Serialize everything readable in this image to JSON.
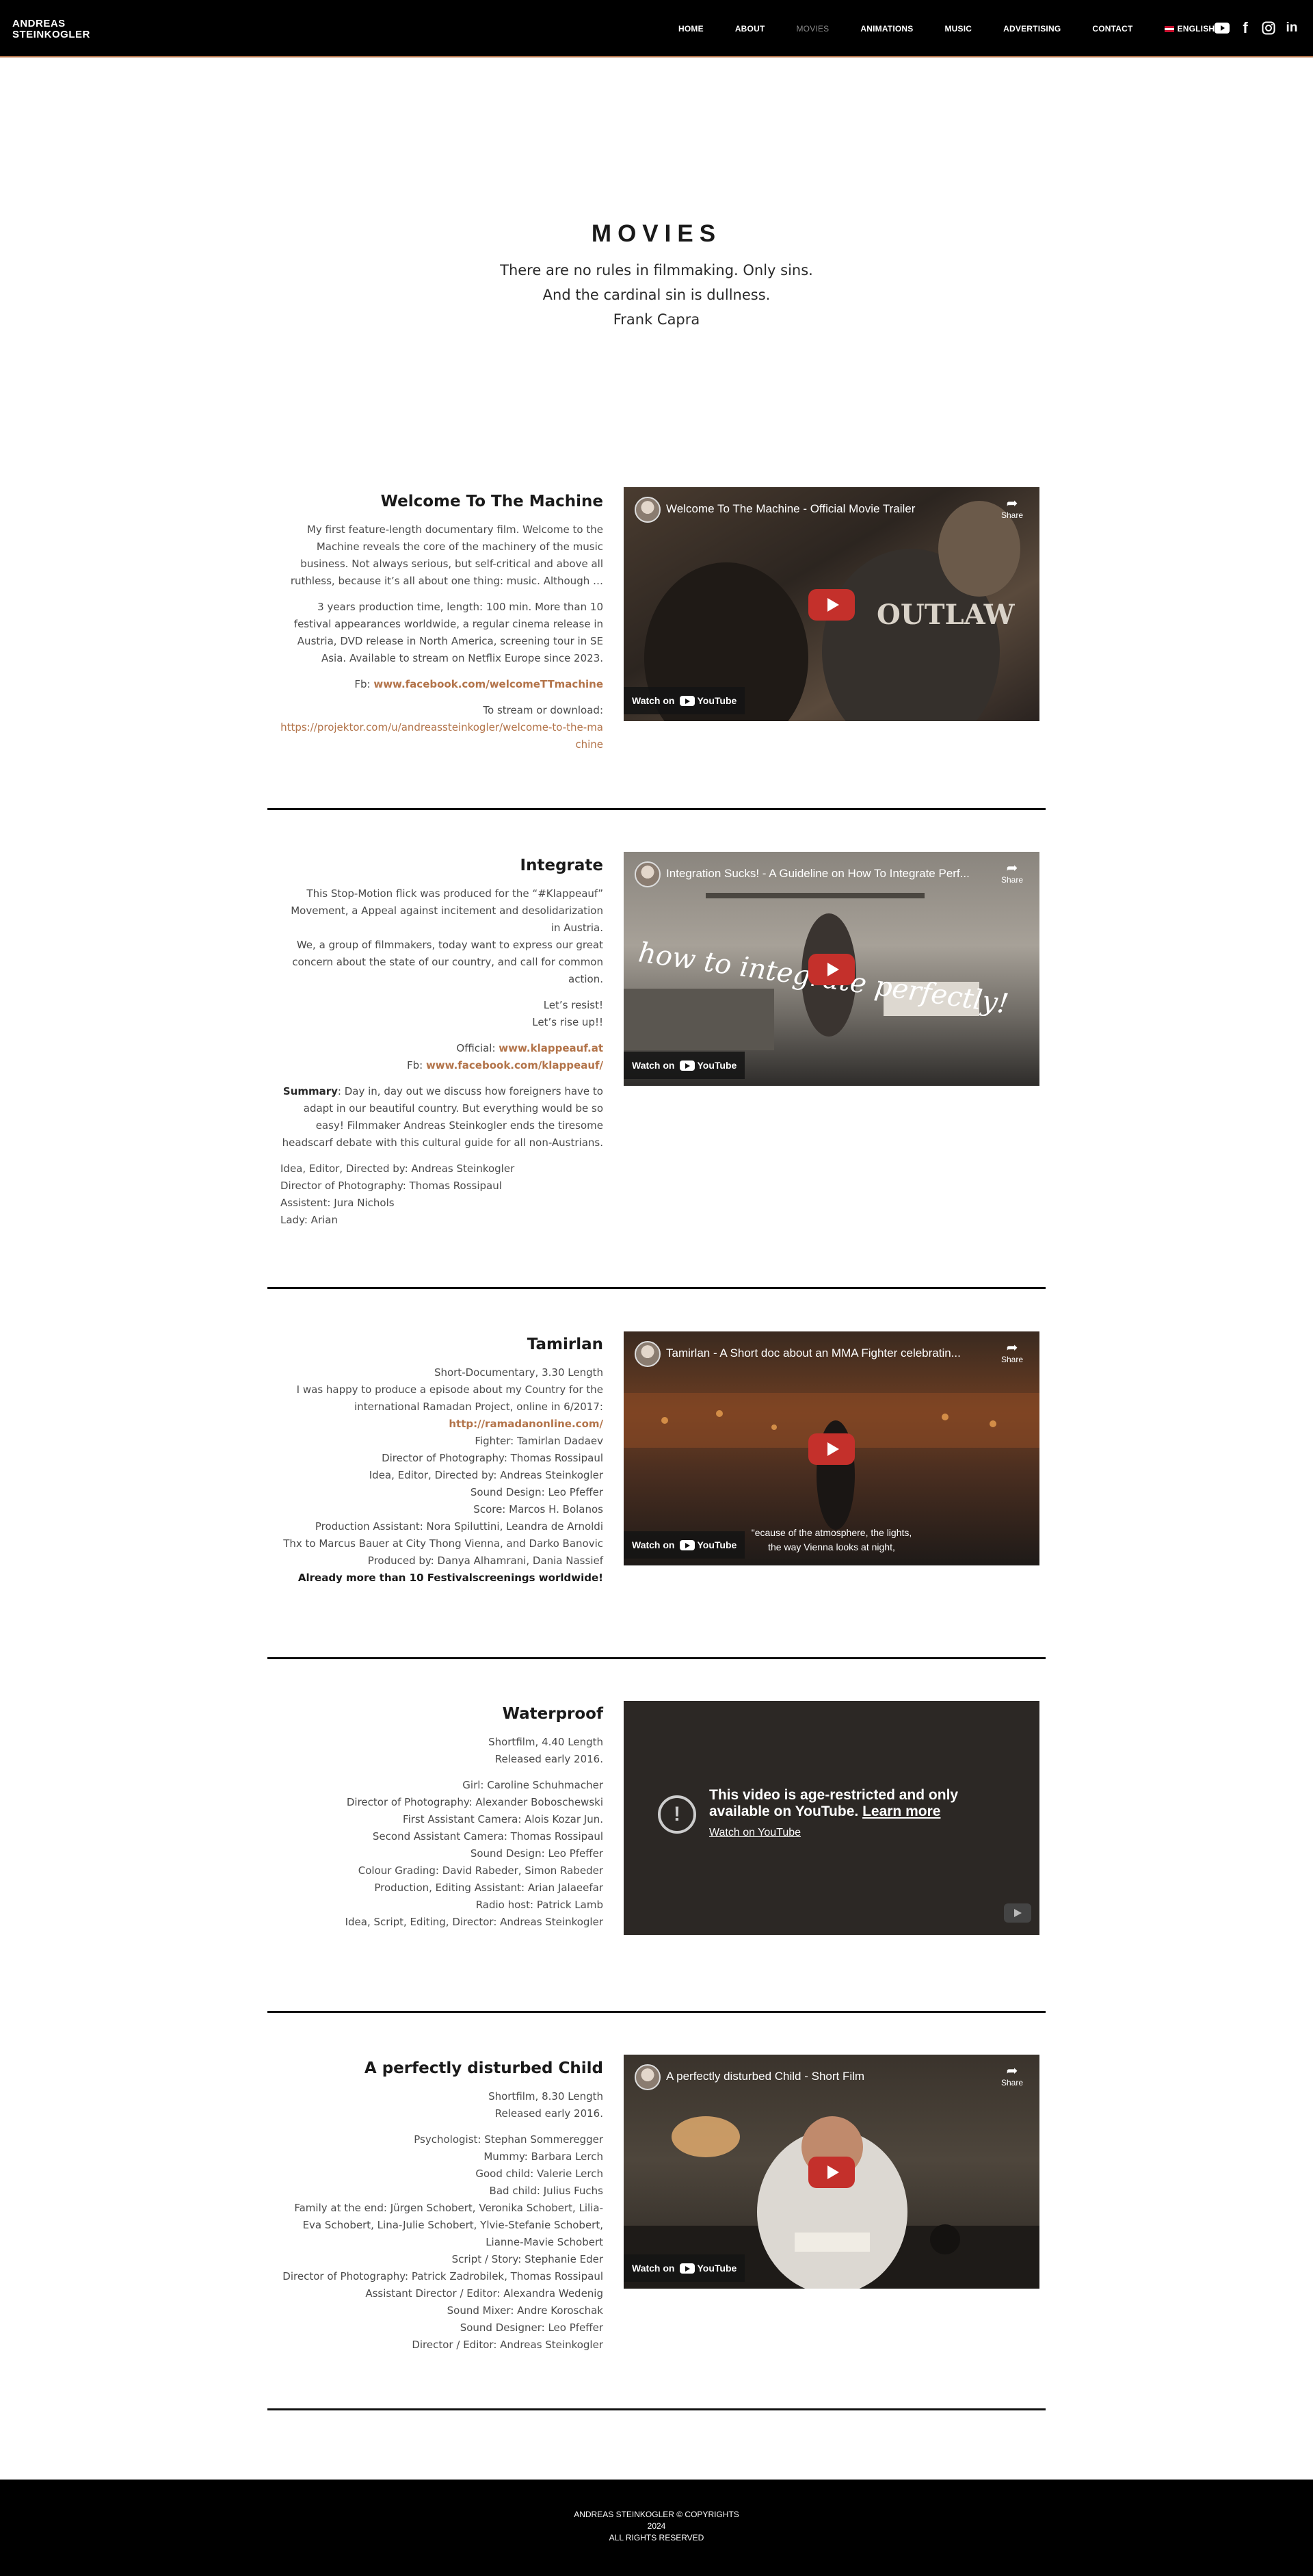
{
  "header": {
    "logo_line1": "ANDREAS",
    "logo_line2": "STEINKOGLER",
    "nav": [
      "HOME",
      "ABOUT",
      "MOVIES",
      "ANIMATIONS",
      "MUSIC",
      "ADVERTISING",
      "CONTACT"
    ],
    "active_nav": "MOVIES",
    "language": "ENGLISH",
    "social": [
      "youtube-icon",
      "facebook-icon",
      "instagram-icon",
      "linkedin-icon"
    ]
  },
  "hero": {
    "title": "MOVIES",
    "quote_line1": "There are no rules in filmmaking. Only sins.",
    "quote_line2": "And the cardinal sin is dullness.",
    "author": "Frank Capra"
  },
  "movies": [
    {
      "title": "Welcome To The Machine",
      "p1": "My first feature-length documentary film.  Welcome to the Machine reveals the core of the machinery of the music business. Not always serious, but self-critical and above all ruthless, because it’s all about one thing: music. Although …",
      "p2": "3 years production time, length: 100 min. More than 10 festival appearances worldwide, a regular cinema release in Austria, DVD release in North America, screening tour in SE Asia. Available to stream on Netflix Europe since 2023.",
      "fb_label": "Fb: ",
      "fb_link": "www.facebook.com/welcomeTTmachine",
      "stream_label": "To stream or download:",
      "stream_link": "https://projektor.com/u/andreassteinkogler/welcome-to-the-machine",
      "video": {
        "title": "Welcome To The Machine - Official Movie Trailer",
        "watch": "Watch on",
        "yt": "YouTube",
        "share": "Share"
      }
    },
    {
      "title": "Integrate",
      "p1": "This Stop-Motion flick was produced for the “#Klappeauf” Movement, a Appeal against incitement and desolidarization in Austria.",
      "p1b": "We, a group of filmmakers, today want to express our great concern about the state of our country, and call for common action.",
      "resist1": "Let’s resist!",
      "resist2": "Let’s rise up!!",
      "official_label": "Official: ",
      "official_link": "www.klappeauf.at",
      "fb_label": "Fb: ",
      "fb_link": "www.facebook.com/klappeauf/",
      "summary_label": "Summary",
      "summary": ": Day in, day out we discuss how foreigners have to adapt in our beautiful country. But everything would be so easy! Filmmaker Andreas Steinkogler ends the tiresome headscarf debate with this cultural guide for all non-Austrians.",
      "credits": [
        "Idea, Editor, Directed by: Andreas Steinkogler",
        "Director of Photography: Thomas Rossipaul",
        "Assistent: Jura Nichols",
        "Lady: Arian"
      ],
      "video": {
        "title": "Integration Sucks! - A Guideline on How To Integrate Perf...",
        "watch": "Watch on",
        "yt": "YouTube",
        "share": "Share",
        "overlay": "how to integrate perfectly!"
      }
    },
    {
      "title": "Tamirlan",
      "line1": "Short-Documentary, 3.30 Length",
      "line2": "I was happy to produce a episode about my Country for the international Ramadan Project, online in 6/2017:",
      "link": "http://ramadanonline.com/",
      "credits": [
        "Fighter: Tamirlan Dadaev",
        "Director of Photography: Thomas Rossipaul",
        "Idea, Editor, Directed by: Andreas Steinkogler",
        "Sound Design: Leo Pfeffer",
        "Score: Marcos H. Bolanos",
        "Production Assistant: Nora Spiluttini, Leandra de Arnoldi",
        "Thx to Marcus Bauer at City Thong Vienna, and Darko Banovic",
        "Produced by: Danya Alhamrani, Dania Nassief"
      ],
      "highlight": "Already more than 10 Festivalscreenings worldwide!",
      "video": {
        "title": "Tamirlan - A Short doc about an MMA Fighter celebratin...",
        "watch": "Watch on",
        "yt": "YouTube",
        "share": "Share",
        "caption1": "\"ecause of the atmosphere, the lights,",
        "caption2": "the way Vienna looks at night,"
      }
    },
    {
      "title": "Waterproof",
      "line1": "Shortfilm, 4.40 Length",
      "line2": "Released early 2016.",
      "credits": [
        "Girl: Caroline Schuhmacher",
        "Director of Photography: Alexander Boboschewski",
        "First Assistant Camera: Alois Kozar Jun.",
        "Second Assistant Camera: Thomas Rossipaul",
        "Sound Design: Leo Pfeffer",
        "Colour Grading: David Rabeder, Simon Rabeder",
        "Production, Editing Assistant: Arian Jalaeefar",
        "Radio host: Patrick Lamb",
        "Idea, Script, Editing, Director: Andreas Steinkogler"
      ],
      "video": {
        "restricted1": "This video is age-restricted and only available on YouTube. ",
        "learn_more": "Learn more",
        "watch_link": "Watch on YouTube"
      }
    },
    {
      "title": "A perfectly disturbed Child",
      "line1": "Shortfilm, 8.30 Length",
      "line2": "Released early 2016.",
      "credits": [
        "Psychologist: Stephan Sommeregger",
        "Mummy: Barbara Lerch",
        "Good child: Valerie Lerch",
        "Bad child: Julius Fuchs",
        "Family at the end: Jürgen Schobert, Veronika Schobert, Lilia-Eva Schobert, Lina-Julie Schobert, Ylvie-Stefanie Schobert, Lianne-Mavie Schobert",
        "Script / Story: Stephanie Eder",
        "Director of Photography: Patrick Zadrobilek, Thomas Rossipaul",
        "Assistant Director / Editor: Alexandra Wedenig",
        "Sound Mixer: Andre Koroschak",
        "Sound Designer: Leo Pfeffer",
        "Director / Editor: Andreas Steinkogler"
      ],
      "video": {
        "title": "A perfectly disturbed Child - Short Film",
        "watch": "Watch on",
        "yt": "YouTube",
        "share": "Share"
      }
    }
  ],
  "footer": {
    "line1": "ANDREAS STEINKOGLER © COPYRIGHTS",
    "line2": "2024",
    "line3": "ALL RIGHTS RESERVED"
  }
}
